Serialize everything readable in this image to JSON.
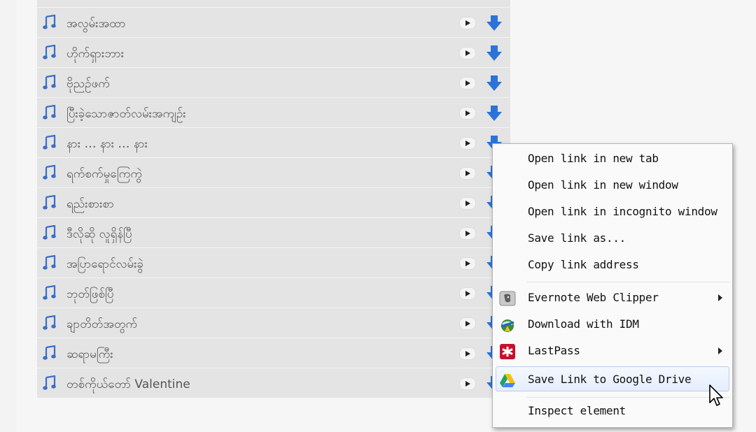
{
  "songs": [
    {
      "title": ""
    },
    {
      "title": "အလွမ်းအထာ"
    },
    {
      "title": "ဟိုက်ရှားဘား"
    },
    {
      "title": "ဗိုညဥ်ဖက်"
    },
    {
      "title": "ပြီးခဲ့သောဇာတ်လမ်းအကျဥ်း"
    },
    {
      "title": "နား … နား … နား"
    },
    {
      "title": "ရက်စက်မှုကြေကွဲ"
    },
    {
      "title": "ရည်းစားစာ"
    },
    {
      "title": "ဒီလိုဆို လူရှိန်ပြီ"
    },
    {
      "title": "အပြာရောင်လမ်းခွဲ"
    },
    {
      "title": "ဘုတ်ဖြစ်ပြီ"
    },
    {
      "title": "ချာတိတ်အတွက်"
    },
    {
      "title": "ဆရာမကြီး"
    },
    {
      "title": "တစ်ကိုယ်တော် Valentine"
    }
  ],
  "context_menu": {
    "items": [
      {
        "label": "Open link in new tab"
      },
      {
        "label": "Open link in new window"
      },
      {
        "label": "Open link in incognito window"
      },
      {
        "label": "Save link as..."
      },
      {
        "label": "Copy link address"
      },
      {
        "label": "Evernote Web Clipper",
        "icon": "evernote-icon",
        "submenu": true
      },
      {
        "label": "Download with IDM",
        "icon": "idm-icon"
      },
      {
        "label": "LastPass",
        "icon": "lastpass-icon",
        "submenu": true
      },
      {
        "label": "Save Link to Google Drive",
        "icon": "google-drive-icon",
        "highlighted": true
      },
      {
        "label": "Inspect element"
      }
    ]
  },
  "colors": {
    "note_icon": "#3a6ec8",
    "download_icon": "#2b73d9",
    "highlight": "#e4eefc"
  }
}
